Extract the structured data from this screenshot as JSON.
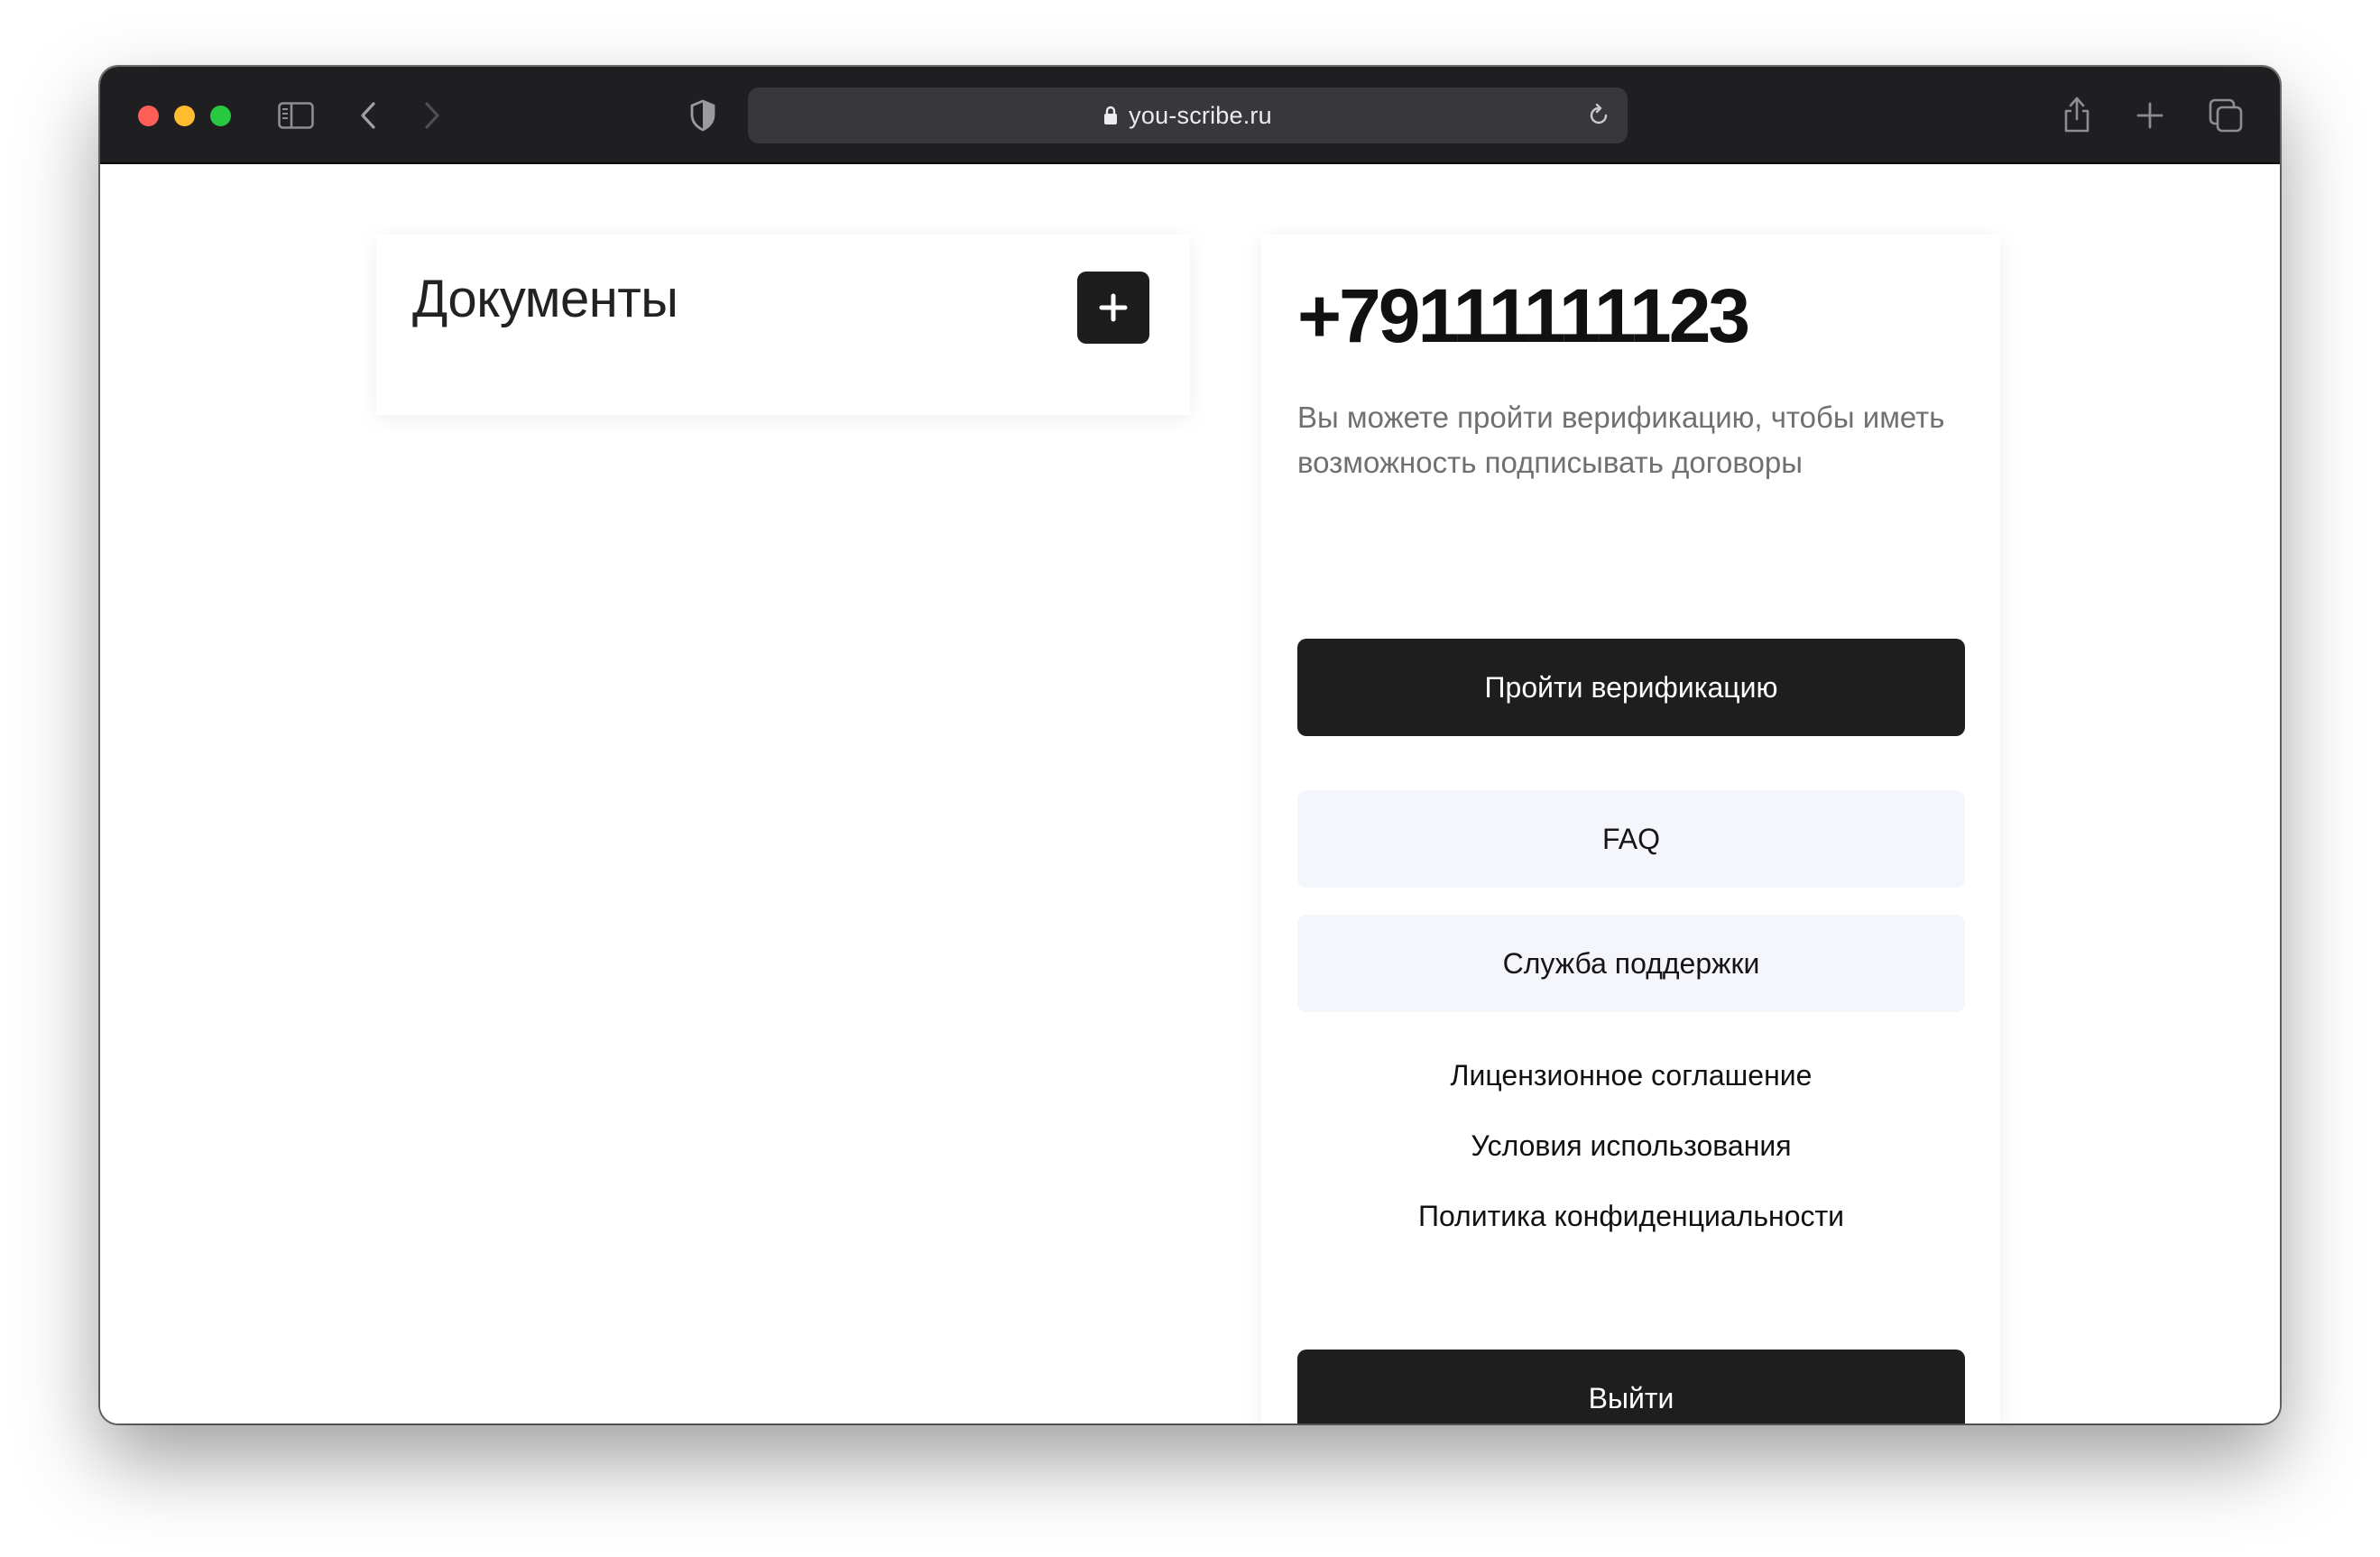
{
  "browser": {
    "url": "you-scribe.ru",
    "icons": [
      "sidebar-toggle-icon",
      "back-arrow-icon",
      "forward-arrow-icon",
      "shield-icon",
      "lock-icon",
      "reload-icon",
      "share-icon",
      "plus-icon",
      "tabs-overview-icon"
    ]
  },
  "documents": {
    "title": "Документы",
    "add_icon": "+"
  },
  "profile": {
    "phone": "+79111111123",
    "description": "Вы можете пройти верификацию, чтобы иметь возможность подписывать договоры",
    "verify_button": "Пройти верификацию",
    "faq_button": "FAQ",
    "support_button": "Служба поддержки",
    "links": [
      "Лицензионное соглашение",
      "Условия использования",
      "Политика конфиденциальности"
    ],
    "logout_button": "Выйти"
  },
  "colors": {
    "titlebar": "#1f1e21",
    "dark_button": "#1e1e1e",
    "light_button": "#f4f6fb"
  }
}
